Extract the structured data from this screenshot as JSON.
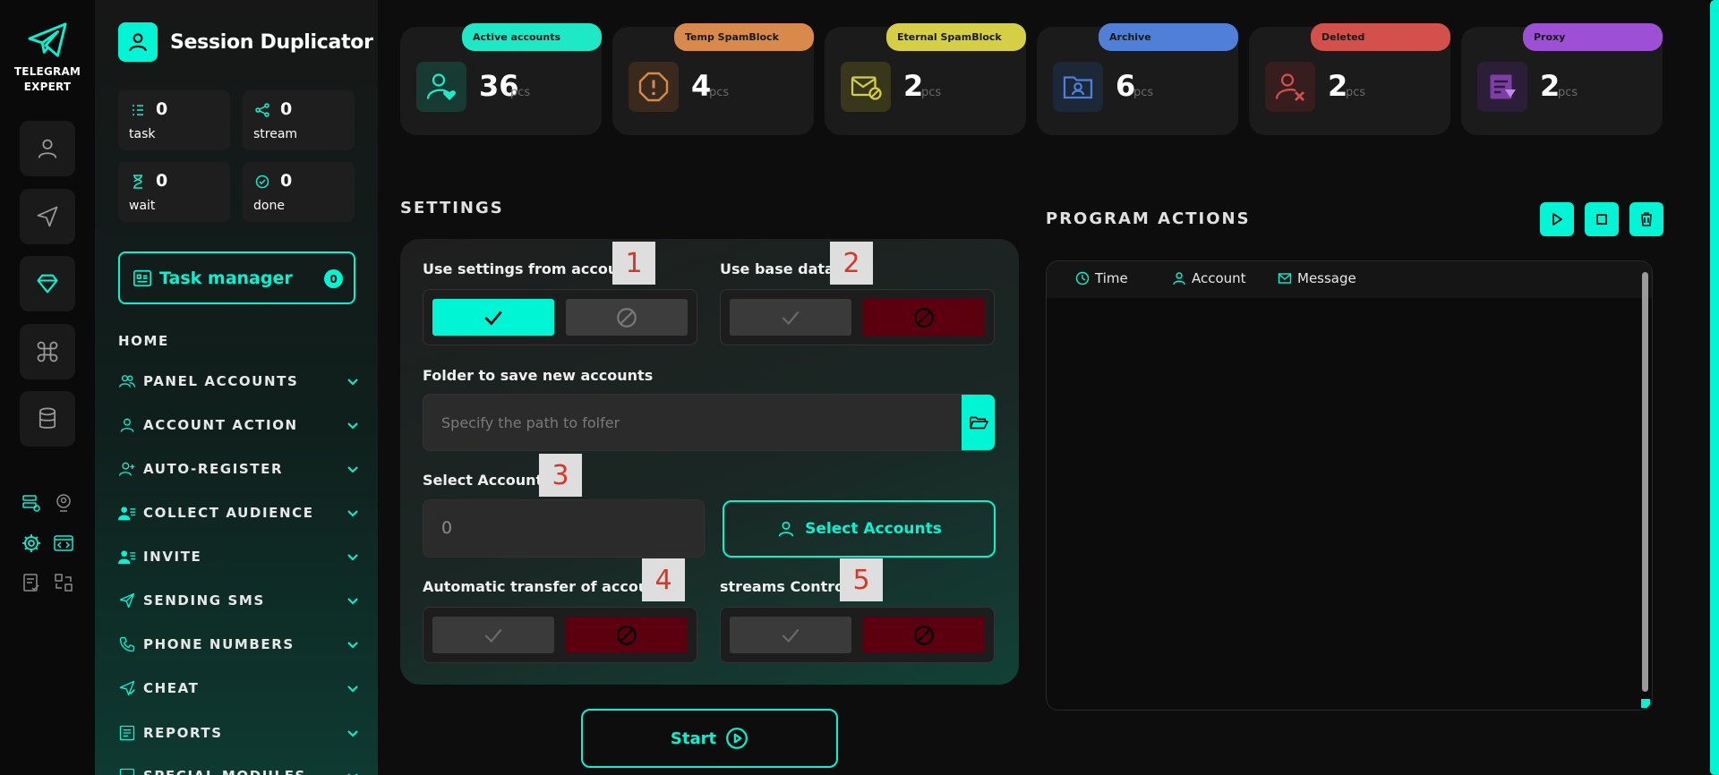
{
  "rail": {
    "brand_line1": "TELEGRAM",
    "brand_line2": "EXPERT",
    "items": [
      {
        "icon": "user-icon"
      },
      {
        "icon": "send-icon"
      },
      {
        "icon": "diamond-icon",
        "active": true
      },
      {
        "icon": "command-icon"
      },
      {
        "icon": "database-icon"
      }
    ],
    "mini_icons": [
      "server-settings-icon",
      "user-pin-icon",
      "gear-icon",
      "code-window-icon",
      "checklist-icon",
      "transfer-icon"
    ]
  },
  "sidebar": {
    "title": "Session Duplicator",
    "stats": [
      {
        "value": "0",
        "label": "task",
        "icon": "task-list-icon"
      },
      {
        "value": "0",
        "label": "stream",
        "icon": "share-icon"
      },
      {
        "value": "0",
        "label": "wait",
        "icon": "hourglass-icon"
      },
      {
        "value": "0",
        "label": "done",
        "icon": "check-circle-icon"
      }
    ],
    "task_manager": {
      "label": "Task manager",
      "count": "0"
    },
    "home": "HOME",
    "nav": [
      {
        "label": "PANEL ACCOUNTS",
        "icon": "users-icon"
      },
      {
        "label": "ACCOUNT ACTION",
        "icon": "user-icon"
      },
      {
        "label": "AUTO-REGISTER",
        "icon": "user-plus-icon"
      },
      {
        "label": "COLLECT AUDIENCE",
        "icon": "user-list-icon"
      },
      {
        "label": "INVITE",
        "icon": "user-list-icon"
      },
      {
        "label": "SENDING SMS",
        "icon": "send-icon"
      },
      {
        "label": "PHONE NUMBERS",
        "icon": "phone-icon"
      },
      {
        "label": "CHEAT",
        "icon": "send-check-icon"
      },
      {
        "label": "REPORTS",
        "icon": "report-icon"
      },
      {
        "label": "SPECIAL MODULES",
        "icon": "module-icon"
      }
    ]
  },
  "cards": [
    {
      "label": "Active accounts",
      "value": "36",
      "unit": "pcs",
      "color": "#1de9c6",
      "icon": "user-heart-icon"
    },
    {
      "label": "Temp SpamBlock",
      "value": "4",
      "unit": "pcs",
      "color": "#d9894a",
      "icon": "warning-octagon-icon"
    },
    {
      "label": "Eternal SpamBlock",
      "value": "2",
      "unit": "pcs",
      "color": "#d4cf45",
      "icon": "mail-block-icon"
    },
    {
      "label": "Archive",
      "value": "6",
      "unit": "pcs",
      "color": "#4f7fd6",
      "icon": "folder-user-icon"
    },
    {
      "label": "Deleted",
      "value": "2",
      "unit": "pcs",
      "color": "#d4504a",
      "icon": "user-x-icon"
    },
    {
      "label": "Proxy",
      "value": "2",
      "unit": "pcs",
      "color": "#9d4fd6",
      "icon": "proxy-icon"
    }
  ],
  "settings": {
    "title": "SETTINGS",
    "use_settings_label": "Use settings from accounts",
    "use_settings_on": true,
    "use_base_label": "Use base data",
    "use_base_on": false,
    "folder_label": "Folder to save new accounts",
    "folder_placeholder": "Specify the path to folfer",
    "select_label": "Select Accounts",
    "select_count": "0",
    "select_button": "Select Accounts",
    "auto_transfer_label": "Automatic transfer of accounts",
    "auto_transfer_on": false,
    "streams_label": "streams Control",
    "streams_on": false,
    "markers": [
      "1",
      "2",
      "3",
      "4",
      "5"
    ],
    "start_label": "Start"
  },
  "actions": {
    "title": "PROGRAM ACTIONS",
    "columns": [
      "Time",
      "Account",
      "Message"
    ]
  },
  "colors": {
    "accent": "#00f5d4",
    "danger": "#5c0010",
    "annotation": "#d43a2a"
  }
}
